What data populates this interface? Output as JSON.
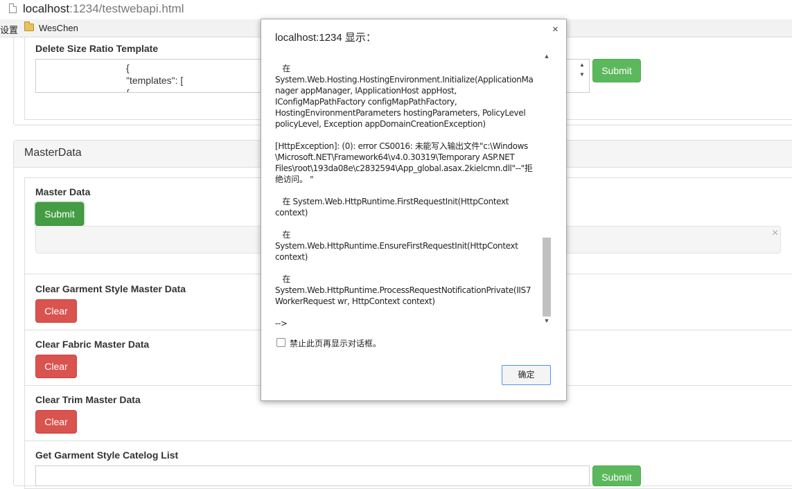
{
  "browser": {
    "url_host": "localhost",
    "url_rest": ":1234/testwebapi.html",
    "bookmarks": {
      "settings_label": "设置",
      "folder_label": "WesChen"
    }
  },
  "delete_template": {
    "label": "Delete Size Ratio Template",
    "textarea_lines": [
      "{",
      "\"templates\": [",
      "{"
    ],
    "submit_label": "Submit"
  },
  "master_panel": {
    "heading": "MasterData",
    "master_data": {
      "label": "Master Data",
      "submit_label": "Submit",
      "close_glyph": "×"
    },
    "clear_garment": {
      "label": "Clear Garment Style Master Data",
      "button_label": "Clear"
    },
    "clear_fabric": {
      "label": "Clear Fabric Master Data",
      "button_label": "Clear"
    },
    "clear_trim": {
      "label": "Clear Trim Master Data",
      "button_label": "Clear"
    },
    "catalog_list": {
      "label": "Get Garment Style Catelog List",
      "submit_label": "Submit"
    }
  },
  "dialog": {
    "title": "localhost:1234 显示：",
    "close_glyph": "×",
    "message_lines": [
      "   在",
      "System.Web.Hosting.HostingEnvironment.Initialize(ApplicationMa",
      "nager appManager, IApplicationHost appHost,",
      "IConfigMapPathFactory configMapPathFactory,",
      "HostingEnvironmentParameters hostingParameters, PolicyLevel",
      "policyLevel, Exception appDomainCreationException)",
      "",
      "[HttpException]: (0): error CS0016: 未能写入输出文件\"c:\\Windows",
      "\\Microsoft.NET\\Framework64\\v4.0.30319\\Temporary ASP.NET",
      "Files\\root\\193da08e\\c2832594\\App_global.asax.2kielcmn.dll\"--\"拒",
      "绝访问。 \"",
      "",
      "   在 System.Web.HttpRuntime.FirstRequestInit(HttpContext",
      "context)",
      "",
      "   在",
      "System.Web.HttpRuntime.EnsureFirstRequestInit(HttpContext",
      "context)",
      "",
      "   在",
      "System.Web.HttpRuntime.ProcessRequestNotificationPrivate(IIS7",
      "WorkerRequest wr, HttpContext context)",
      "",
      "-->"
    ],
    "checkbox_label": "禁止此页再显示对话框。",
    "ok_label": "确定"
  }
}
